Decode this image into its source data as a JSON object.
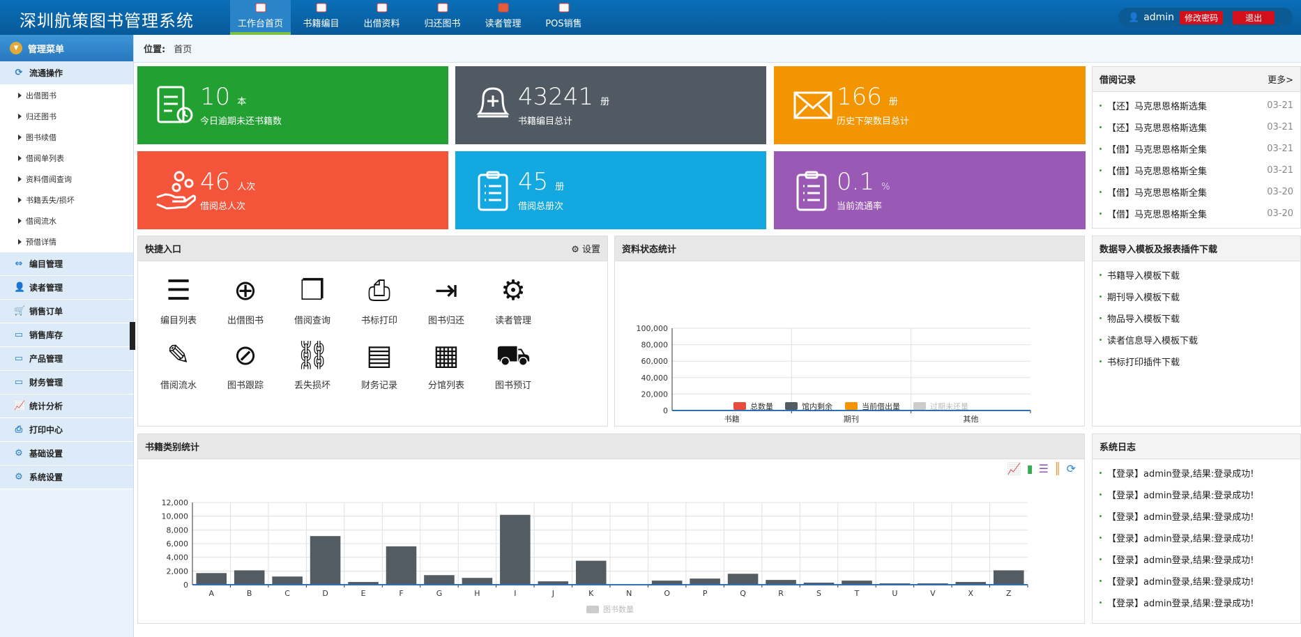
{
  "app": {
    "title": "深圳航策图书管理系统"
  },
  "nav": [
    {
      "label": "工作台首页",
      "icon": "home-icon"
    },
    {
      "label": "书籍编目",
      "icon": "books-icon"
    },
    {
      "label": "出借资料",
      "icon": "lend-doc-icon"
    },
    {
      "label": "归还图书",
      "icon": "return-book-icon"
    },
    {
      "label": "读者管理",
      "icon": "reader-icon"
    },
    {
      "label": "POS销售",
      "icon": "pos-icon"
    }
  ],
  "user": {
    "name": "admin",
    "change_pwd": "修改密码",
    "logout": "退出"
  },
  "sidebar": {
    "title": "管理菜单",
    "groups": [
      {
        "label": "流通操作",
        "icon": "circulation-icon"
      },
      {
        "label": "编目管理",
        "icon": "catalog-icon"
      },
      {
        "label": "读者管理",
        "icon": "user-icon"
      },
      {
        "label": "销售订单",
        "icon": "cart-icon"
      },
      {
        "label": "销售库存",
        "icon": "inventory-icon"
      },
      {
        "label": "产品管理",
        "icon": "product-icon"
      },
      {
        "label": "财务管理",
        "icon": "finance-icon"
      },
      {
        "label": "统计分析",
        "icon": "chart-icon"
      },
      {
        "label": "打印中心",
        "icon": "printer-icon"
      },
      {
        "label": "基础设置",
        "icon": "gear-icon"
      },
      {
        "label": "系统设置",
        "icon": "gear-icon"
      }
    ],
    "subitems": [
      "出借图书",
      "归还图书",
      "图书续借",
      "借阅单列表",
      "资料借阅查询",
      "书籍丢失/损坏",
      "借阅流水",
      "预借详情"
    ]
  },
  "breadcrumb": {
    "label": "位置:",
    "current": "首页"
  },
  "stats": [
    {
      "value": "10",
      "unit": "本",
      "label": "今日逾期未还书籍数",
      "color": "#22a132",
      "icon": "overdue-icon"
    },
    {
      "value": "43241",
      "unit": "册",
      "label": "书籍编目总计",
      "color": "#515a62",
      "icon": "bell-icon"
    },
    {
      "value": "166",
      "unit": "册",
      "label": "历史下架数目总计",
      "color": "#f29500",
      "icon": "mail-icon"
    },
    {
      "value": "46",
      "unit": "人次",
      "label": "借阅总人次",
      "color": "#f4553a",
      "icon": "hand-icon"
    },
    {
      "value": "45",
      "unit": "册",
      "label": "借阅总册次",
      "color": "#14a8e1",
      "icon": "clipboard-icon"
    },
    {
      "value": "0.1",
      "unit": "%",
      "label": "当前流通率",
      "color": "#9b59b6",
      "icon": "clipboard-icon"
    }
  ],
  "borrow_records": {
    "title": "借阅记录",
    "more": "更多>",
    "items": [
      {
        "text": "【还】马克思恩格斯选集",
        "date": "03-21"
      },
      {
        "text": "【还】马克思恩格斯选集",
        "date": "03-21"
      },
      {
        "text": "【借】马克思恩格斯全集",
        "date": "03-21"
      },
      {
        "text": "【借】马克思恩格斯全集",
        "date": "03-21"
      },
      {
        "text": "【借】马克思恩格斯全集",
        "date": "03-20"
      },
      {
        "text": "【借】马克思恩格斯全集",
        "date": "03-20"
      }
    ]
  },
  "quick": {
    "title": "快捷入口",
    "settings": "设置",
    "items": [
      {
        "label": "编目列表",
        "icon": "catalog-list-icon",
        "glyph": "☰"
      },
      {
        "label": "出借图书",
        "icon": "plus-circle-icon",
        "glyph": "⊕"
      },
      {
        "label": "借阅查询",
        "icon": "query-icon",
        "glyph": "❐"
      },
      {
        "label": "书标打印",
        "icon": "printer-icon",
        "glyph": "⎙"
      },
      {
        "label": "图书归还",
        "icon": "return-icon",
        "glyph": "⇥"
      },
      {
        "label": "读者管理",
        "icon": "reader-gear-icon",
        "glyph": "⚙"
      },
      {
        "label": "借阅流水",
        "icon": "edit-doc-icon",
        "glyph": "✎"
      },
      {
        "label": "图书跟踪",
        "icon": "track-icon",
        "glyph": "⊘"
      },
      {
        "label": "丢失损坏",
        "icon": "broken-link-icon",
        "glyph": "⛓"
      },
      {
        "label": "财务记录",
        "icon": "finance-doc-icon",
        "glyph": "▤"
      },
      {
        "label": "分馆列表",
        "icon": "building-icon",
        "glyph": "▦"
      },
      {
        "label": "图书预订",
        "icon": "truck-icon",
        "glyph": "⛟"
      }
    ]
  },
  "status_chart": {
    "title": "资料状态统计",
    "legend": [
      {
        "name": "总数量",
        "color": "#ea4c3b"
      },
      {
        "name": "馆内剩余",
        "color": "#535b63"
      },
      {
        "name": "当前借出量",
        "color": "#f29500"
      },
      {
        "name": "过期未还量",
        "color": "#cccccc"
      }
    ]
  },
  "downloads": {
    "title": "数据导入模板及报表插件下载",
    "items": [
      "书籍导入模板下载",
      "期刊导入模板下载",
      "物品导入模板下载",
      "读者信息导入模板下载",
      "书标打印插件下载"
    ]
  },
  "category_chart": {
    "title": "书籍类别统计",
    "legend": "图书数量"
  },
  "syslog": {
    "title": "系统日志",
    "items": [
      "【登录】admin登录,结果:登录成功!",
      "【登录】admin登录,结果:登录成功!",
      "【登录】admin登录,结果:登录成功!",
      "【登录】admin登录,结果:登录成功!",
      "【登录】admin登录,结果:登录成功!",
      "【登录】admin登录,结果:登录成功!",
      "【登录】admin登录,结果:登录成功!"
    ]
  },
  "chart_data": [
    {
      "type": "bar",
      "categories": [
        "书籍",
        "期刊",
        "其他"
      ],
      "series": [
        {
          "name": "总数量",
          "values": [
            0,
            0,
            0
          ]
        },
        {
          "name": "馆内剩余",
          "values": [
            0,
            0,
            0
          ]
        },
        {
          "name": "当前借出量",
          "values": [
            0,
            0,
            0
          ]
        },
        {
          "name": "过期未还量",
          "values": [
            0,
            0,
            0
          ]
        }
      ],
      "ylim": [
        0,
        100000
      ],
      "yticks": [
        "0",
        "20,000",
        "40,000",
        "60,000",
        "80,000",
        "100,000"
      ]
    },
    {
      "type": "bar",
      "categories": [
        "A",
        "B",
        "C",
        "D",
        "E",
        "F",
        "G",
        "H",
        "I",
        "J",
        "K",
        "N",
        "O",
        "P",
        "Q",
        "R",
        "S",
        "T",
        "U",
        "V",
        "X",
        "Z"
      ],
      "series": [
        {
          "name": "图书数量",
          "values": [
            1700,
            2100,
            1200,
            7100,
            400,
            5600,
            1400,
            1000,
            10200,
            500,
            3500,
            100,
            600,
            900,
            1600,
            700,
            300,
            600,
            200,
            200,
            400,
            2100
          ]
        }
      ],
      "ylim": [
        0,
        12000
      ],
      "yticks": [
        "0",
        "2,000",
        "4,000",
        "6,000",
        "8,000",
        "10,000",
        "12,000"
      ]
    }
  ]
}
